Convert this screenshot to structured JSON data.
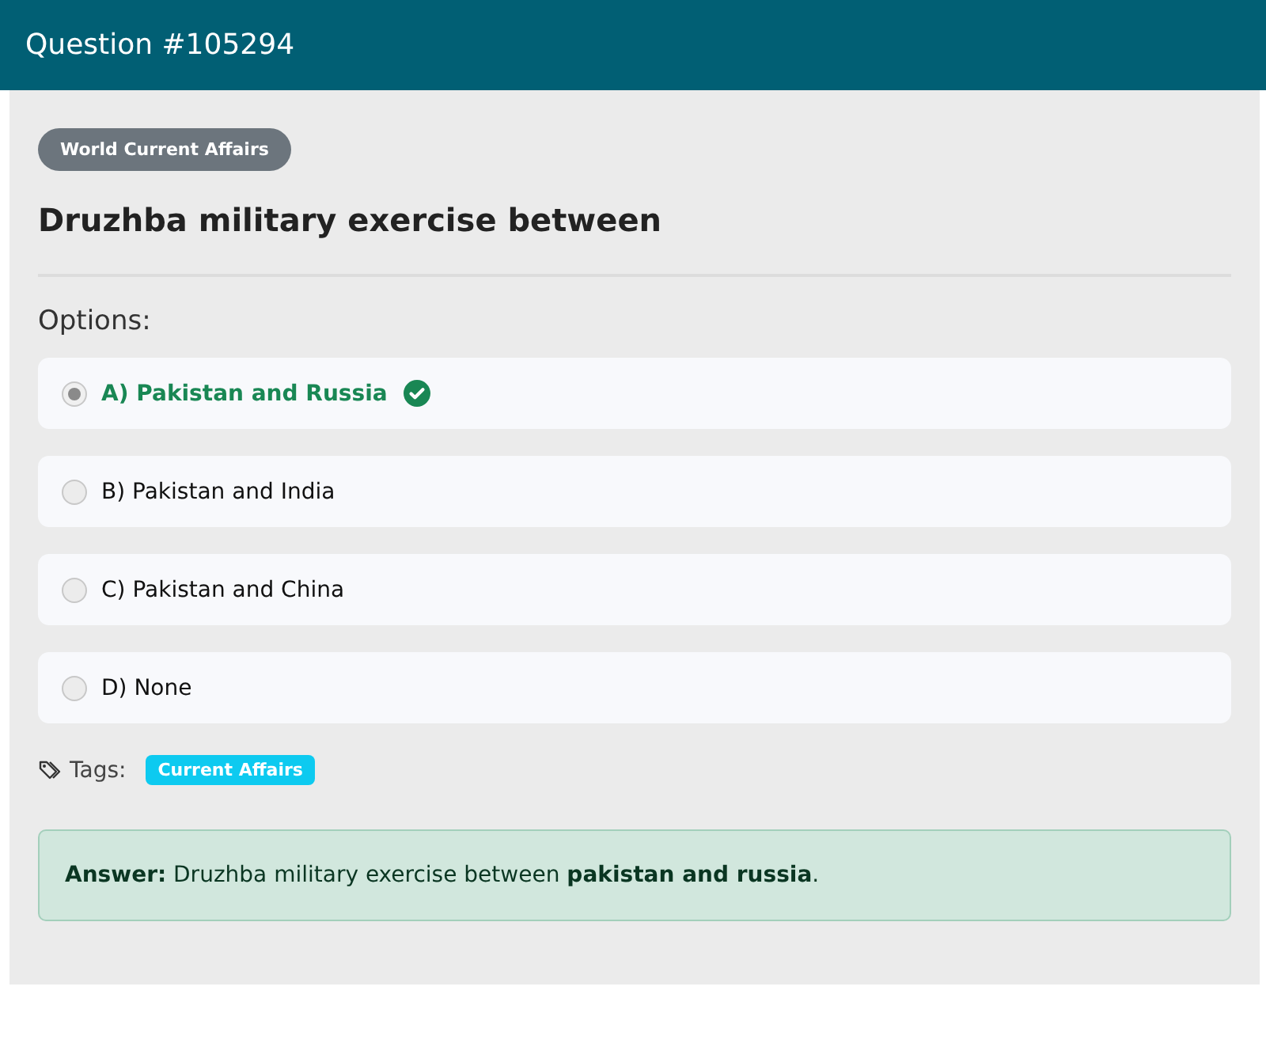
{
  "header": {
    "title": "Question #105294"
  },
  "category": "World Current Affairs",
  "question": "Druzhba military exercise between",
  "options_label": "Options:",
  "options": [
    {
      "label": "A) Pakistan and Russia",
      "selected": true,
      "correct": true
    },
    {
      "label": "B) Pakistan and India",
      "selected": false,
      "correct": false
    },
    {
      "label": "C) Pakistan and China",
      "selected": false,
      "correct": false
    },
    {
      "label": "D) None",
      "selected": false,
      "correct": false
    }
  ],
  "tags_label": "Tags:",
  "tags": [
    "Current Affairs"
  ],
  "answer": "**Answer:** Druzhba military exercise between **pakistan and russia**."
}
